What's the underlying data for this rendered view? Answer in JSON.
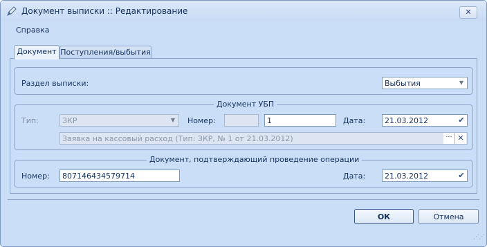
{
  "window": {
    "title": "Документ выписки :: Редактирование",
    "close_glyph": "✕",
    "app_icon": "pen-icon"
  },
  "menu": {
    "help_label": "Справка"
  },
  "tabs": [
    {
      "label": "Документ",
      "active": true
    },
    {
      "label": "Поступления/выбытия",
      "active": false
    }
  ],
  "statement_section": {
    "label": "Раздел выписки:",
    "value": "Выбытия"
  },
  "ubp_document": {
    "legend": "Документ УБП",
    "type_label": "Тип:",
    "type_value": "ЗКР",
    "number_label": "Номер:",
    "number_prefix": "",
    "number_value": "1",
    "date_label": "Дата:",
    "date_value": "21.03.2012",
    "linked_doc": "Заявка на кассовый расход (Тип: ЗКР, № 1 от 21.03.2012)",
    "browse_glyph": "···",
    "clear_glyph": "✕"
  },
  "operation_document": {
    "legend": "Документ, подтверждающий проведение операции",
    "number_label": "Номер:",
    "number_value": "807146434579714",
    "date_label": "Дата:",
    "date_value": "21.03.2012"
  },
  "buttons": {
    "ok": "ОК",
    "cancel": "Отмена"
  },
  "colors": {
    "background": "#cadef7",
    "border": "#8ba3c7",
    "text": "#15315c"
  }
}
